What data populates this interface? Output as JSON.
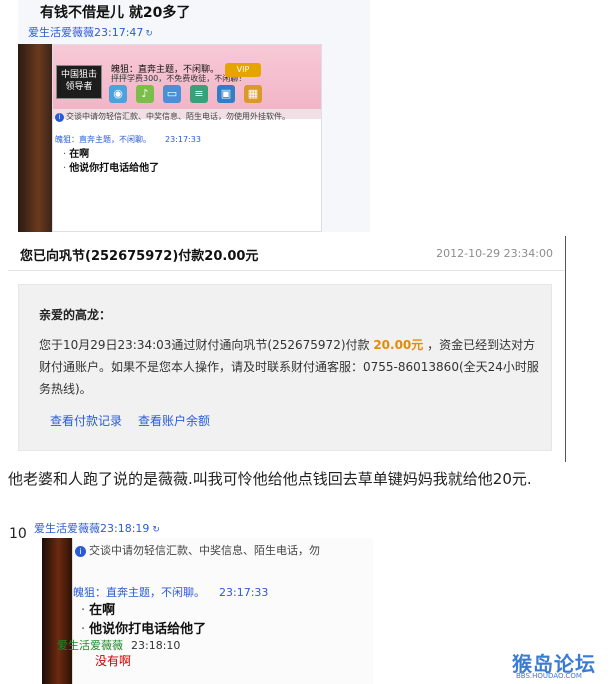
{
  "screenshot1": {
    "top_message": "有钱不借是儿  就20多了",
    "sender_name": "爱生活爱薇薇",
    "sender_time": "23:17:47",
    "avatar_text": "中国狙击\n领导者",
    "signature_line1": "魄狙：直奔主题，不闲聊。",
    "signature_line2": "抨抨学费300，不免费收徒，不闲聊！",
    "badge_text": "VIP",
    "warning_text": "交谈中请勿轻信汇款、中奖信息、陌生电话，勿使用外挂软件。",
    "chat_name": "魄狙：直奔主题，不闲聊。",
    "chat_time": "23:17:33",
    "line1": "在啊",
    "line2": "他说你打电话给他了"
  },
  "payment": {
    "title": "您已向巩节(252675972)付款20.00元",
    "time": "2012-10-29 23:34:00",
    "greeting": "亲爱的高龙：",
    "body_before": "您于10月29日23:34:03通过财付通向巩节(252675972)付款 ",
    "amount": "20.00元",
    "body_after": " ，资金已经到达对方财付通账户。如果不是您本人操作，请及时联系财付通客服：0755-86013860(全天24小时服务热线)。",
    "link_records": "查看付款记录",
    "link_balance": "查看账户余额"
  },
  "caption": "他老婆和人跑了说的是薇薇.叫我可怜他给他点钱回去草单键妈妈我就给他20元.",
  "screenshot2": {
    "number": "10",
    "sender_name": "爱生活爱薇薇",
    "sender_time": "23:18:19",
    "warning_text": "交谈中请勿轻信汇款、中奖信息、陌生电话，勿",
    "chat_name": "魄狙：直奔主题，不闲聊。",
    "chat_time": "23:17:33",
    "line1": "在啊",
    "line2": "他说你打电话给他了",
    "sender2_name": "爱生活爱薇薇",
    "sender2_time": "23:18:10",
    "reply": "没有啊"
  },
  "watermark": {
    "main": "猴岛论坛",
    "sub": "BBS.HOUDAO.COM"
  },
  "colors": {
    "link_blue": "#2a5bd7",
    "amount_orange": "#e88a00",
    "reply_red": "#d00000"
  }
}
